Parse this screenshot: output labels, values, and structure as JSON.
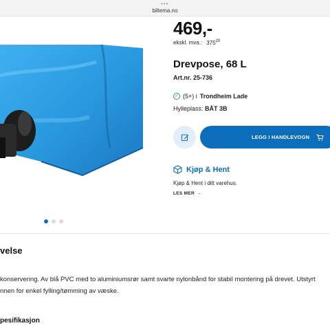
{
  "browser": {
    "url": "biltema.no"
  },
  "product": {
    "price": "469,-",
    "ex_vat_label": "ekskl. mva.:",
    "ex_vat_value": "375",
    "ex_vat_cents": "20",
    "title": "Drevpose, 68 L",
    "article_number": "Art.nr. 25-736",
    "stock_count": "(5+) i",
    "stock_store": "Trondheim Lade",
    "shelf_label": "Hylleplass:",
    "shelf_value": "BÅT 3B"
  },
  "actions": {
    "add_to_cart": "LEGG I HANDLEVOGN"
  },
  "click_collect": {
    "title": "Kjøp & Hent",
    "description": "Kjøp & Hent i ditt varehus.",
    "read_more": "LES MER"
  },
  "gallery": {
    "count": 3,
    "active": 0
  },
  "description": {
    "heading": "velse",
    "line1": "konservering. Av blå PVC med to aluminiumsrør samt svarte nylonbånd for stabil montering på drevet. Utstyrt",
    "line2": "nnen for enkel fylling/tømming av væske."
  },
  "spec": {
    "heading": "pesifikasjon"
  },
  "colors": {
    "accent": "#0c6dbb",
    "in_stock": "#2ea84a",
    "product_blue": "#2a9ae0"
  },
  "icons": [
    "check-circle-icon",
    "edit-icon",
    "cart-icon",
    "package-icon",
    "arrow-right-icon"
  ]
}
